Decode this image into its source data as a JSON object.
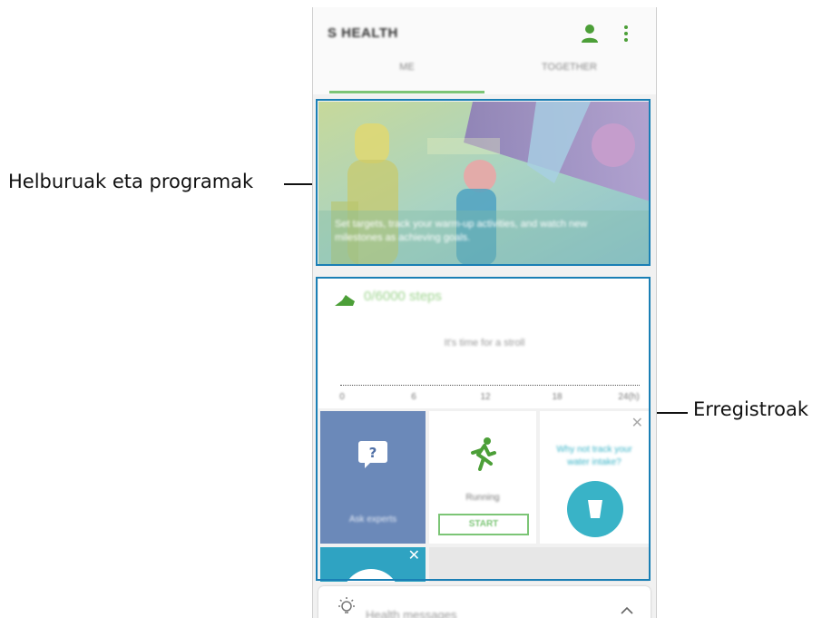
{
  "callouts": {
    "goals_programs": "Helburuak eta programak",
    "trackers": "Erregistroak"
  },
  "app": {
    "title": "S HEALTH",
    "tabs": [
      "ME",
      "TOGETHER"
    ],
    "accent_color": "#7cc576",
    "highlight_color": "#1a7fb5"
  },
  "hero": {
    "text": "Set targets, track your warm-up activities, and watch new milestones as achieving goals."
  },
  "steps": {
    "value": "0/6000 steps",
    "hint": "It's time for a stroll",
    "ticks": [
      "0",
      "6",
      "12",
      "18",
      "24(h)"
    ]
  },
  "tiles": {
    "ask_experts": "Ask experts",
    "running": "Running",
    "start": "START",
    "water_prompt": "Why not track your water intake?"
  },
  "messages": {
    "label": "Health messages"
  },
  "icons": {
    "user": "user-icon",
    "more": "more-vert-icon",
    "shoe": "shoe-icon",
    "question": "question-bubble-icon",
    "runner": "runner-icon",
    "cup": "cup-icon",
    "close": "close-icon",
    "bulb": "lightbulb-icon",
    "chevron": "chevron-up-icon"
  }
}
